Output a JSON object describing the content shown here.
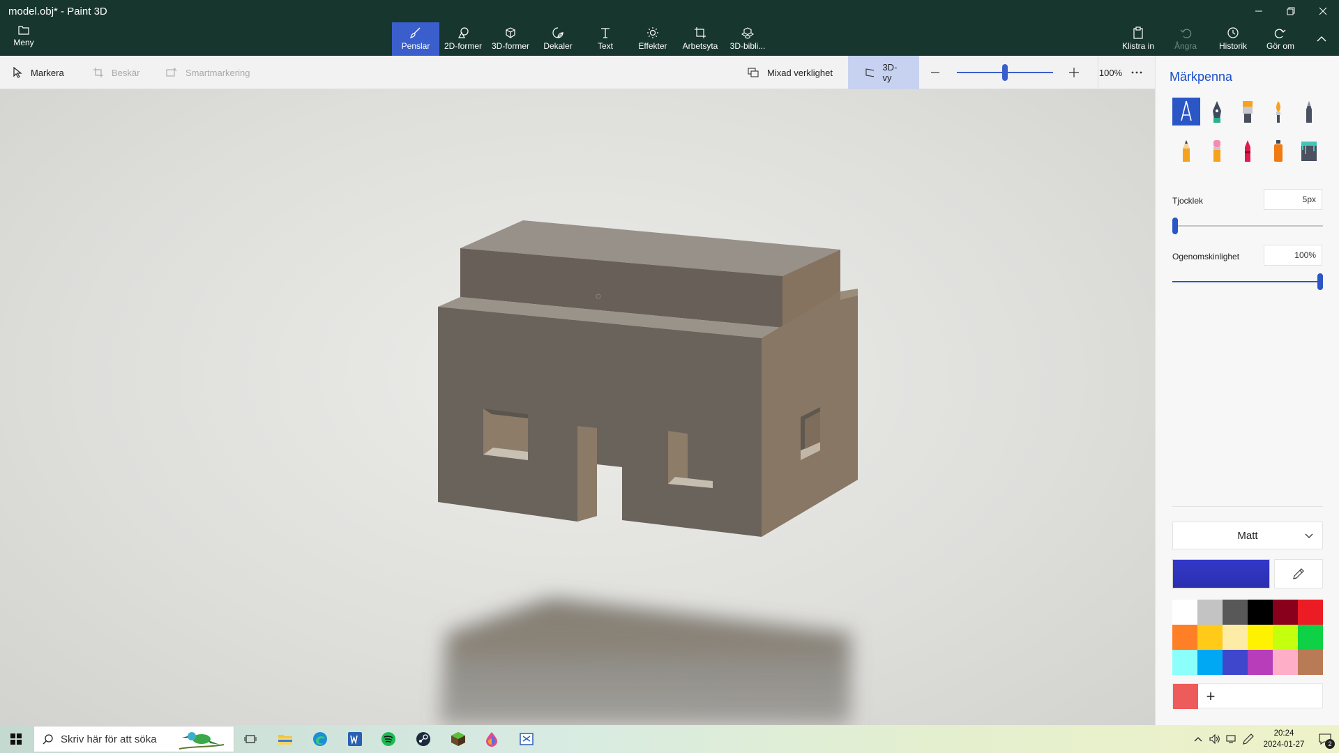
{
  "window": {
    "title": "model.obj* - Paint 3D"
  },
  "menu": {
    "label": "Meny"
  },
  "ribbon": {
    "tabs": [
      {
        "label": "Penslar",
        "icon": "brush-icon",
        "active": true
      },
      {
        "label": "2D-former",
        "icon": "2d-shapes-icon"
      },
      {
        "label": "3D-former",
        "icon": "3d-shapes-icon"
      },
      {
        "label": "Dekaler",
        "icon": "stickers-icon"
      },
      {
        "label": "Text",
        "icon": "text-icon"
      },
      {
        "label": "Effekter",
        "icon": "effects-icon"
      },
      {
        "label": "Arbetsyta",
        "icon": "canvas-icon"
      },
      {
        "label": "3D-bibli...",
        "icon": "3d-library-icon"
      }
    ],
    "right": {
      "paste": "Klistra in",
      "undo": "Ångra",
      "history": "Historik",
      "redo": "Gör om"
    }
  },
  "toolbar": {
    "select": "Markera",
    "crop": "Beskär",
    "magic_select": "Smartmarkering",
    "mixed_reality": "Mixad verklighet",
    "view_3d": "3D-vy",
    "zoom": "100%",
    "zoom_level": 0.5
  },
  "panel": {
    "title": "Märkpenna",
    "thickness_label": "Tjocklek",
    "thickness_value": "5px",
    "thickness_level": 0.02,
    "opacity_label": "Ogenomskinlighet",
    "opacity_value": "100%",
    "opacity_level": 1.0,
    "finish": "Matt",
    "current_color": "#3438c8",
    "palette": [
      "#ffffff",
      "#c3c3c3",
      "#585858",
      "#000000",
      "#88001b",
      "#ec1c24",
      "#ff7f27",
      "#ffca18",
      "#fdeca6",
      "#fff200",
      "#c4ff0e",
      "#0ed145",
      "#8cfffb",
      "#00a8f3",
      "#3f48cc",
      "#b83dba",
      "#ffaec8",
      "#b97a56"
    ],
    "custom_color": "#ee5b5b",
    "brushes": [
      "marker-icon",
      "calligraphy-pen-icon",
      "oil-brush-icon",
      "watercolor-icon",
      "pixel-pen-icon",
      "pencil-icon",
      "eraser-icon",
      "crayon-icon",
      "spray-can-icon",
      "fill-bucket-icon"
    ]
  },
  "taskbar": {
    "search_placeholder": "Skriv här för att söka",
    "time": "20:24",
    "date": "2024-01-27",
    "notification_count": "2"
  }
}
